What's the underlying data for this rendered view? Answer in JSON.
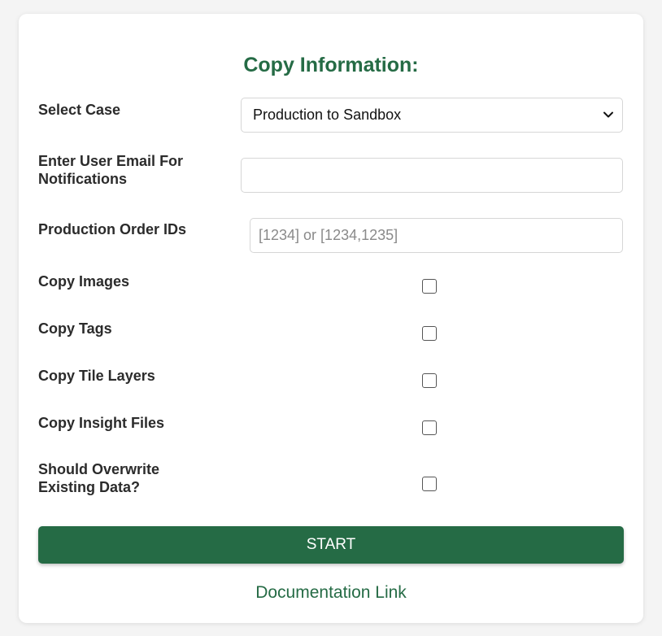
{
  "form": {
    "title": "Copy Information:",
    "select_case": {
      "label": "Select Case",
      "value": "Production to Sandbox"
    },
    "email": {
      "label": "Enter User Email For Notifications",
      "value": ""
    },
    "order_ids": {
      "label": "Production Order IDs",
      "placeholder": "[1234] or [1234,1235]",
      "value": ""
    },
    "copy_images": {
      "label": "Copy Images",
      "checked": false
    },
    "copy_tags": {
      "label": "Copy Tags",
      "checked": false
    },
    "copy_tile_layers": {
      "label": "Copy Tile Layers",
      "checked": false
    },
    "copy_insight_files": {
      "label": "Copy Insight Files",
      "checked": false
    },
    "overwrite": {
      "label": "Should Overwrite Existing Data?",
      "checked": false
    },
    "start_label": "START",
    "doc_link_label": "Documentation Link"
  },
  "colors": {
    "accent": "#256b45",
    "background": "#f4f4f4",
    "card": "#ffffff"
  },
  "icons": {
    "select_chevron": "chevron-down-icon"
  }
}
